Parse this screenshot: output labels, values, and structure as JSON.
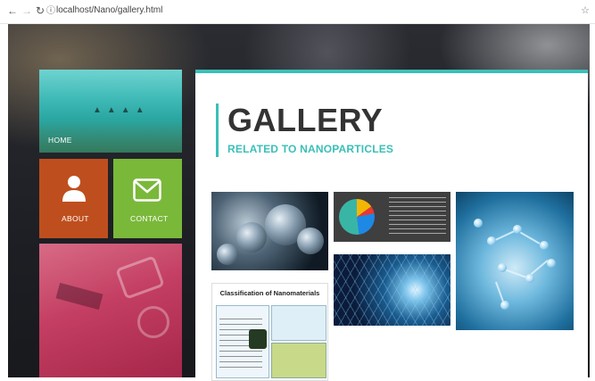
{
  "browser": {
    "back_icon": "arrow-left",
    "forward_icon": "arrow-right",
    "reload_icon": "reload",
    "info_icon": "info-circle",
    "url": "localhost/Nano/gallery.html",
    "star_icon": "bookmark-star"
  },
  "tiles": {
    "home": {
      "label": "HOME"
    },
    "about": {
      "label": "ABOUT",
      "icon": "user-icon",
      "color": "#bf4e1e"
    },
    "contact": {
      "label": "CONTACT",
      "icon": "envelope-icon",
      "color": "#7ab83a"
    }
  },
  "content": {
    "title": "GALLERY",
    "subtitle": "RELATED TO NANOPARTICLES",
    "accent": "#3bbfb8"
  },
  "gallery": {
    "classification_title": "Classification of Nanomaterials"
  }
}
